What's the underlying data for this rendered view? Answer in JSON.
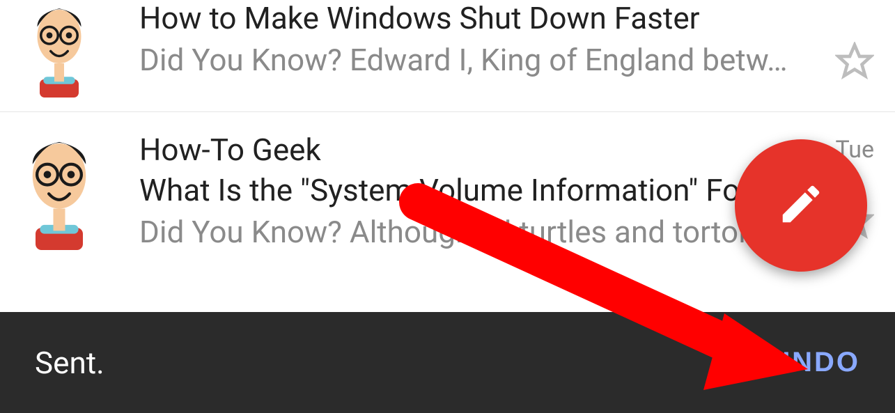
{
  "emails": [
    {
      "sender": "",
      "subject": "How to Make Windows Shut Down Faster",
      "preview": "Did You Know? Edward I, King of England betw…",
      "date": ""
    },
    {
      "sender": "How-To Geek",
      "subject": "What Is the \"System Volume Information\" Fo",
      "preview": "Did You Know? Although all turtles and tortoise…",
      "date": "Tue"
    }
  ],
  "snackbar": {
    "message": "Sent.",
    "action": "UNDO"
  }
}
